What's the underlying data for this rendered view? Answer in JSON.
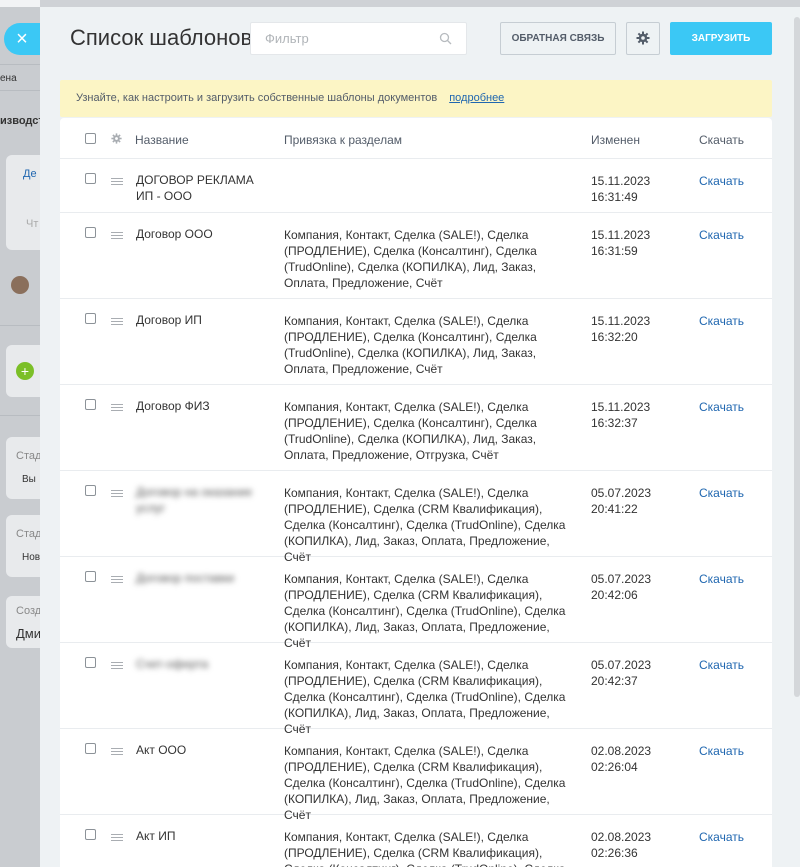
{
  "close_button": "×",
  "bg": {
    "lines": [
      "ена",
      "изводст",
      "Де",
      "Чт",
      "Стад",
      "Вы",
      "Стад",
      "Нов",
      "Созд",
      "Дми"
    ]
  },
  "header": {
    "title": "Список шаблонов",
    "filter_placeholder": "Фильтр",
    "feedback_label": "ОБРАТНАЯ СВЯЗЬ",
    "upload_label": "ЗАГРУЗИТЬ"
  },
  "notice": {
    "text": "Узнайте, как настроить и загрузить собственные шаблоны документов",
    "link": "подробнее"
  },
  "table": {
    "columns": {
      "name": "Название",
      "sections": "Привязка к разделам",
      "changed": "Изменен",
      "download": "Скачать"
    },
    "rows": [
      {
        "name": "ДОГОВОР РЕКЛАМА ИП - ООО",
        "sections": "",
        "date": "15.11.2023",
        "time": "16:31:49",
        "download": "Скачать",
        "blurred": false
      },
      {
        "name": "Договор ООО",
        "sections": "Компания, Контакт, Сделка (SALE!), Сделка (ПРОДЛЕНИЕ), Сделка (Консалтинг), Сделка (TrudOnline), Сделка (КОПИЛКА), Лид, Заказ, Оплата, Предложение, Счёт",
        "date": "15.11.2023",
        "time": "16:31:59",
        "download": "Скачать",
        "blurred": false
      },
      {
        "name": "Договор ИП",
        "sections": "Компания, Контакт, Сделка (SALE!), Сделка (ПРОДЛЕНИЕ), Сделка (Консалтинг), Сделка (TrudOnline), Сделка (КОПИЛКА), Лид, Заказ, Оплата, Предложение, Счёт",
        "date": "15.11.2023",
        "time": "16:32:20",
        "download": "Скачать",
        "blurred": false
      },
      {
        "name": "Договор ФИЗ",
        "sections": "Компания, Контакт, Сделка (SALE!), Сделка (ПРОДЛЕНИЕ), Сделка (Консалтинг), Сделка (TrudOnline), Сделка (КОПИЛКА), Лид, Заказ, Оплата, Предложение, Отгрузка, Счёт",
        "date": "15.11.2023",
        "time": "16:32:37",
        "download": "Скачать",
        "blurred": false
      },
      {
        "name": "Договор на оказание услуг",
        "sections": "Компания, Контакт, Сделка (SALE!), Сделка (ПРОДЛЕНИЕ), Сделка (CRM Квалификация), Сделка (Консалтинг), Сделка (TrudOnline), Сделка (КОПИЛКА), Лид, Заказ, Оплата, Предложение, Счёт",
        "date": "05.07.2023",
        "time": "20:41:22",
        "download": "Скачать",
        "blurred": true
      },
      {
        "name": "Договор поставки",
        "sections": "Компания, Контакт, Сделка (SALE!), Сделка (ПРОДЛЕНИЕ), Сделка (CRM Квалификация), Сделка (Консалтинг), Сделка (TrudOnline), Сделка (КОПИЛКА), Лид, Заказ, Оплата, Предложение, Счёт",
        "date": "05.07.2023",
        "time": "20:42:06",
        "download": "Скачать",
        "blurred": true
      },
      {
        "name": "Счет-оферта",
        "sections": "Компания, Контакт, Сделка (SALE!), Сделка (ПРОДЛЕНИЕ), Сделка (CRM Квалификация), Сделка (Консалтинг), Сделка (TrudOnline), Сделка (КОПИЛКА), Лид, Заказ, Оплата, Предложение, Счёт",
        "date": "05.07.2023",
        "time": "20:42:37",
        "download": "Скачать",
        "blurred": true
      },
      {
        "name": "Акт ООО",
        "sections": "Компания, Контакт, Сделка (SALE!), Сделка (ПРОДЛЕНИЕ), Сделка (CRM Квалификация), Сделка (Консалтинг), Сделка (TrudOnline), Сделка (КОПИЛКА), Лид, Заказ, Оплата, Предложение, Счёт",
        "date": "02.08.2023",
        "time": "02:26:04",
        "download": "Скачать",
        "blurred": false
      },
      {
        "name": "Акт ИП",
        "sections": "Компания, Контакт, Сделка (SALE!), Сделка (ПРОДЛЕНИЕ), Сделка (CRM Квалификация), Сделка (Консалтинг), Сделка (TrudOnline), Сделка (КОПИЛКА), Лид, Заказ, Оплата, Предложение, Счёт",
        "date": "02.08.2023",
        "time": "02:26:36",
        "download": "Скачать",
        "blurred": false
      }
    ]
  }
}
